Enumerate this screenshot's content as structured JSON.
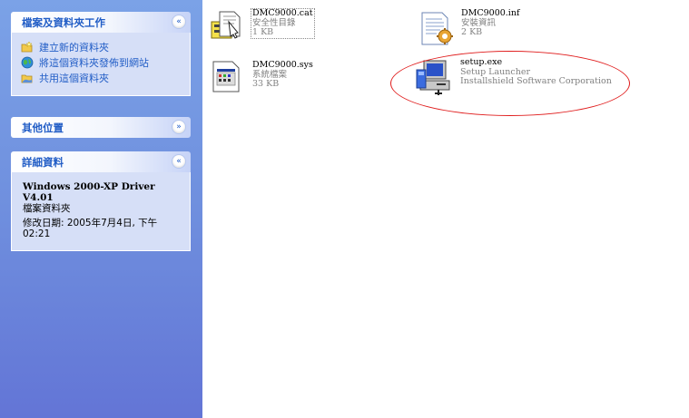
{
  "sidebar": {
    "file_tasks": {
      "title": "檔案及資料夾工作",
      "collapse_glyph": "«",
      "items": [
        {
          "label": "建立新的資料夾",
          "icon": "new-folder-icon"
        },
        {
          "label": "將這個資料夾發佈到網站",
          "icon": "publish-web-icon"
        },
        {
          "label": "共用這個資料夾",
          "icon": "share-folder-icon"
        }
      ]
    },
    "other_places": {
      "title": "其他位置",
      "expand_glyph": "»"
    },
    "details": {
      "title": "詳細資料",
      "collapse_glyph": "«",
      "name_line1": "Windows 2000-XP Driver",
      "name_line2": "V4.01",
      "type": "檔案資料夾",
      "modified": "修改日期: 2005年7月4日, 下午 02:21"
    }
  },
  "files": [
    {
      "name": "DMC9000.cat",
      "type": "安全性目錄",
      "size": "1 KB",
      "icon": "security-catalog-icon"
    },
    {
      "name": "DMC9000.inf",
      "type": "安裝資訊",
      "size": "2 KB",
      "icon": "setup-information-icon"
    },
    {
      "name": "DMC9000.sys",
      "type": "系統檔案",
      "size": "33 KB",
      "icon": "system-file-icon"
    },
    {
      "name": "setup.exe",
      "type": "Setup Launcher",
      "size": "Installshield Software Corporation",
      "icon": "setup-launcher-icon"
    }
  ],
  "colors": {
    "sidebar_top": "#7ba2e7",
    "sidebar_bottom": "#6375d6",
    "task_link": "#215dc6",
    "annotation": "#e01e1e"
  }
}
